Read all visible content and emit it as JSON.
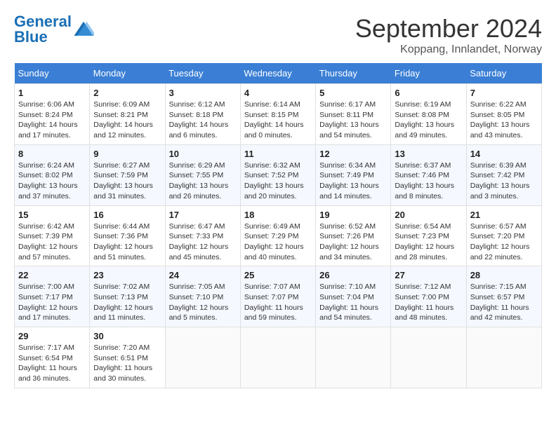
{
  "header": {
    "logo_general": "General",
    "logo_blue": "Blue",
    "month_title": "September 2024",
    "location": "Koppang, Innlandet, Norway"
  },
  "days_of_week": [
    "Sunday",
    "Monday",
    "Tuesday",
    "Wednesday",
    "Thursday",
    "Friday",
    "Saturday"
  ],
  "weeks": [
    [
      {
        "day": "1",
        "info": "Sunrise: 6:06 AM\nSunset: 8:24 PM\nDaylight: 14 hours\nand 17 minutes."
      },
      {
        "day": "2",
        "info": "Sunrise: 6:09 AM\nSunset: 8:21 PM\nDaylight: 14 hours\nand 12 minutes."
      },
      {
        "day": "3",
        "info": "Sunrise: 6:12 AM\nSunset: 8:18 PM\nDaylight: 14 hours\nand 6 minutes."
      },
      {
        "day": "4",
        "info": "Sunrise: 6:14 AM\nSunset: 8:15 PM\nDaylight: 14 hours\nand 0 minutes."
      },
      {
        "day": "5",
        "info": "Sunrise: 6:17 AM\nSunset: 8:11 PM\nDaylight: 13 hours\nand 54 minutes."
      },
      {
        "day": "6",
        "info": "Sunrise: 6:19 AM\nSunset: 8:08 PM\nDaylight: 13 hours\nand 49 minutes."
      },
      {
        "day": "7",
        "info": "Sunrise: 6:22 AM\nSunset: 8:05 PM\nDaylight: 13 hours\nand 43 minutes."
      }
    ],
    [
      {
        "day": "8",
        "info": "Sunrise: 6:24 AM\nSunset: 8:02 PM\nDaylight: 13 hours\nand 37 minutes."
      },
      {
        "day": "9",
        "info": "Sunrise: 6:27 AM\nSunset: 7:59 PM\nDaylight: 13 hours\nand 31 minutes."
      },
      {
        "day": "10",
        "info": "Sunrise: 6:29 AM\nSunset: 7:55 PM\nDaylight: 13 hours\nand 26 minutes."
      },
      {
        "day": "11",
        "info": "Sunrise: 6:32 AM\nSunset: 7:52 PM\nDaylight: 13 hours\nand 20 minutes."
      },
      {
        "day": "12",
        "info": "Sunrise: 6:34 AM\nSunset: 7:49 PM\nDaylight: 13 hours\nand 14 minutes."
      },
      {
        "day": "13",
        "info": "Sunrise: 6:37 AM\nSunset: 7:46 PM\nDaylight: 13 hours\nand 8 minutes."
      },
      {
        "day": "14",
        "info": "Sunrise: 6:39 AM\nSunset: 7:42 PM\nDaylight: 13 hours\nand 3 minutes."
      }
    ],
    [
      {
        "day": "15",
        "info": "Sunrise: 6:42 AM\nSunset: 7:39 PM\nDaylight: 12 hours\nand 57 minutes."
      },
      {
        "day": "16",
        "info": "Sunrise: 6:44 AM\nSunset: 7:36 PM\nDaylight: 12 hours\nand 51 minutes."
      },
      {
        "day": "17",
        "info": "Sunrise: 6:47 AM\nSunset: 7:33 PM\nDaylight: 12 hours\nand 45 minutes."
      },
      {
        "day": "18",
        "info": "Sunrise: 6:49 AM\nSunset: 7:29 PM\nDaylight: 12 hours\nand 40 minutes."
      },
      {
        "day": "19",
        "info": "Sunrise: 6:52 AM\nSunset: 7:26 PM\nDaylight: 12 hours\nand 34 minutes."
      },
      {
        "day": "20",
        "info": "Sunrise: 6:54 AM\nSunset: 7:23 PM\nDaylight: 12 hours\nand 28 minutes."
      },
      {
        "day": "21",
        "info": "Sunrise: 6:57 AM\nSunset: 7:20 PM\nDaylight: 12 hours\nand 22 minutes."
      }
    ],
    [
      {
        "day": "22",
        "info": "Sunrise: 7:00 AM\nSunset: 7:17 PM\nDaylight: 12 hours\nand 17 minutes."
      },
      {
        "day": "23",
        "info": "Sunrise: 7:02 AM\nSunset: 7:13 PM\nDaylight: 12 hours\nand 11 minutes."
      },
      {
        "day": "24",
        "info": "Sunrise: 7:05 AM\nSunset: 7:10 PM\nDaylight: 12 hours\nand 5 minutes."
      },
      {
        "day": "25",
        "info": "Sunrise: 7:07 AM\nSunset: 7:07 PM\nDaylight: 11 hours\nand 59 minutes."
      },
      {
        "day": "26",
        "info": "Sunrise: 7:10 AM\nSunset: 7:04 PM\nDaylight: 11 hours\nand 54 minutes."
      },
      {
        "day": "27",
        "info": "Sunrise: 7:12 AM\nSunset: 7:00 PM\nDaylight: 11 hours\nand 48 minutes."
      },
      {
        "day": "28",
        "info": "Sunrise: 7:15 AM\nSunset: 6:57 PM\nDaylight: 11 hours\nand 42 minutes."
      }
    ],
    [
      {
        "day": "29",
        "info": "Sunrise: 7:17 AM\nSunset: 6:54 PM\nDaylight: 11 hours\nand 36 minutes."
      },
      {
        "day": "30",
        "info": "Sunrise: 7:20 AM\nSunset: 6:51 PM\nDaylight: 11 hours\nand 30 minutes."
      },
      null,
      null,
      null,
      null,
      null
    ]
  ]
}
